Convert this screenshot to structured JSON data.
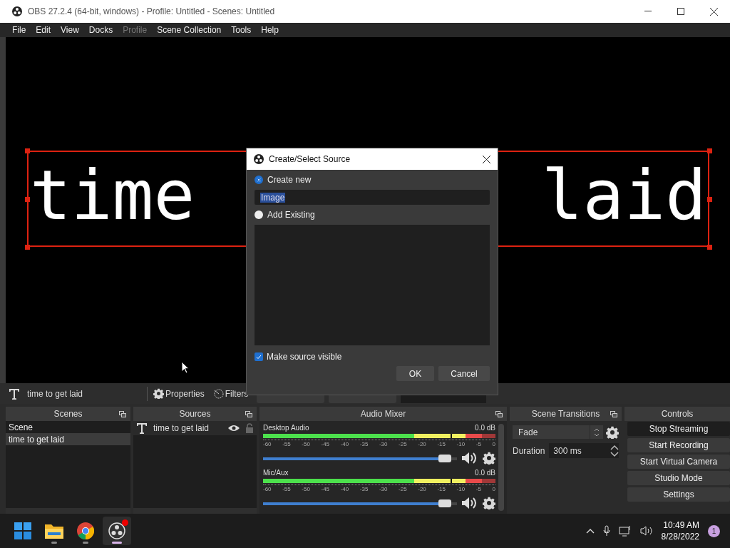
{
  "window": {
    "title": "OBS 27.2.4 (64-bit, windows) - Profile: Untitled - Scenes: Untitled"
  },
  "menu": [
    {
      "label": "File",
      "disabled": false
    },
    {
      "label": "Edit",
      "disabled": false
    },
    {
      "label": "View",
      "disabled": false
    },
    {
      "label": "Docks",
      "disabled": false
    },
    {
      "label": "Profile",
      "disabled": true
    },
    {
      "label": "Scene Collection",
      "disabled": false
    },
    {
      "label": "Tools",
      "disabled": false
    },
    {
      "label": "Help",
      "disabled": false
    }
  ],
  "preview": {
    "text_left": "time",
    "text_right": "laid",
    "selected": true
  },
  "source_toolbar": {
    "source_name": "time to get laid",
    "buttons": [
      "Properties",
      "Filters"
    ]
  },
  "dialog": {
    "title": "Create/Select Source",
    "options": [
      {
        "label": "Create new",
        "selected": true
      },
      {
        "label": "Add Existing",
        "selected": false
      }
    ],
    "name_value": "Image",
    "visible_checkbox": {
      "label": "Make source visible",
      "checked": true
    },
    "buttons": [
      "OK",
      "Cancel"
    ]
  },
  "scenes": {
    "title": "Scenes",
    "items": [
      {
        "label": "Scene",
        "selected": false
      },
      {
        "label": "time to get laid",
        "selected": true
      }
    ]
  },
  "sources": {
    "title": "Sources",
    "items": [
      {
        "label": "time to get laid",
        "visible": true,
        "locked": false
      }
    ]
  },
  "audio_mixer": {
    "title": "Audio Mixer",
    "channels": [
      {
        "name": "Desktop Audio",
        "reading": "0.0 dB",
        "level": 0.97,
        "scale": [
          "-60",
          "-55",
          "-50",
          "-45",
          "-40",
          "-35",
          "-30",
          "-25",
          "-20",
          "-15",
          "-10",
          "-5",
          "0"
        ]
      },
      {
        "name": "Mic/Aux",
        "reading": "0.0 dB",
        "level": 0.97,
        "scale": [
          "-60",
          "-55",
          "-50",
          "-45",
          "-40",
          "-35",
          "-30",
          "-25",
          "-20",
          "-15",
          "-10",
          "-5",
          "0"
        ]
      }
    ]
  },
  "scene_transitions": {
    "title": "Scene Transitions",
    "transition": "Fade",
    "duration_label": "Duration",
    "duration": "300 ms"
  },
  "controls": {
    "title": "Controls",
    "buttons": [
      {
        "label": "Stop Streaming",
        "active": true
      },
      {
        "label": "Start Recording",
        "active": false
      },
      {
        "label": "Start Virtual Camera",
        "active": false
      },
      {
        "label": "Studio Mode",
        "active": false
      },
      {
        "label": "Settings",
        "active": false
      }
    ]
  },
  "taskbar": {
    "apps": [
      {
        "kind": "explorer",
        "running": true,
        "selected": false
      },
      {
        "kind": "browser",
        "running": true,
        "selected": false
      },
      {
        "kind": "obs",
        "running": true,
        "selected": true
      }
    ],
    "time": "10:49 AM",
    "date": "8/28/2022",
    "notifications": "1"
  }
}
